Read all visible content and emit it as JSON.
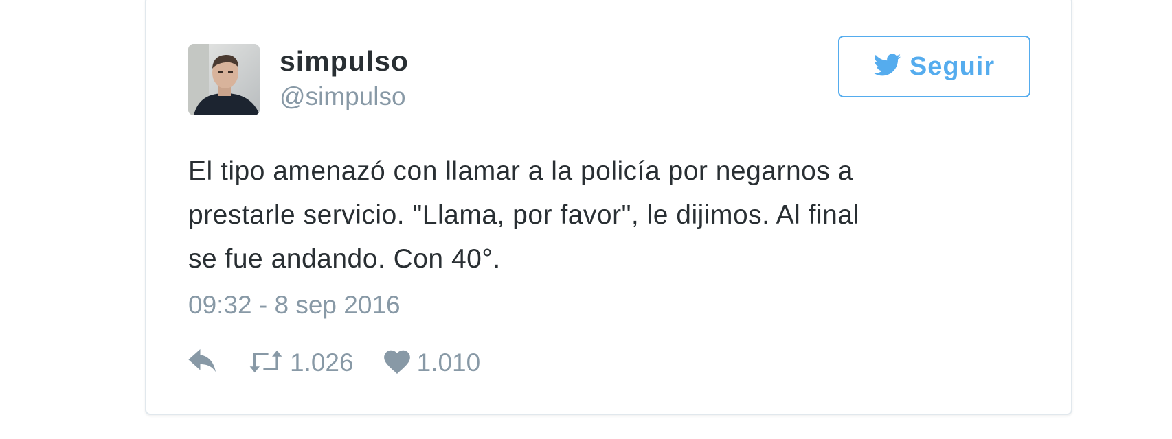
{
  "tweet": {
    "author": {
      "name": "simpulso",
      "handle": "@simpulso"
    },
    "follow_button": {
      "label": "Seguir",
      "icon": "twitter-bird-icon"
    },
    "text_lines": [
      "El tipo amenazó con llamar a la policía por negarnos a",
      "prestarle servicio. \"Llama, por favor\", le dijimos. Al final",
      "se fue andando. Con 40°."
    ],
    "timestamp": "09:32 - 8 sep 2016",
    "actions": {
      "reply": {
        "icon": "reply-icon"
      },
      "retweet": {
        "icon": "retweet-icon",
        "count": "1.026"
      },
      "like": {
        "icon": "heart-icon",
        "count": "1.010"
      }
    }
  },
  "colors": {
    "brand": "#55acee",
    "text": "#292f33",
    "muted": "#8899a6",
    "border": "#e1e8ed"
  }
}
